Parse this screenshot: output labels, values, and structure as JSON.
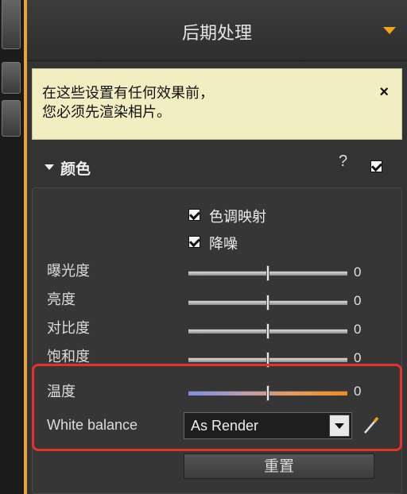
{
  "header": {
    "title": "后期处理"
  },
  "notice": {
    "line1": "在这些设置有任何效果前，",
    "line2": "您必须先渲染相片。",
    "close": "×"
  },
  "section": {
    "title": "颜色",
    "help": "?",
    "enabled": true
  },
  "options": [
    {
      "label": "色调映射",
      "checked": true
    },
    {
      "label": "降噪",
      "checked": true
    }
  ],
  "sliders": [
    {
      "label": "曝光度",
      "value": "0",
      "position": 0.5
    },
    {
      "label": "亮度",
      "value": "0",
      "position": 0.5
    },
    {
      "label": "对比度",
      "value": "0",
      "position": 0.5
    },
    {
      "label": "饱和度",
      "value": "0",
      "position": 0.5
    },
    {
      "label": "温度",
      "value": "0",
      "position": 0.5
    }
  ],
  "white_balance": {
    "label": "White balance",
    "value": "As Render"
  },
  "reset": {
    "label": "重置"
  },
  "colors": {
    "accent": "#f0a51d",
    "highlight": "#e6322a",
    "notice_bg": "#f2eec2"
  }
}
